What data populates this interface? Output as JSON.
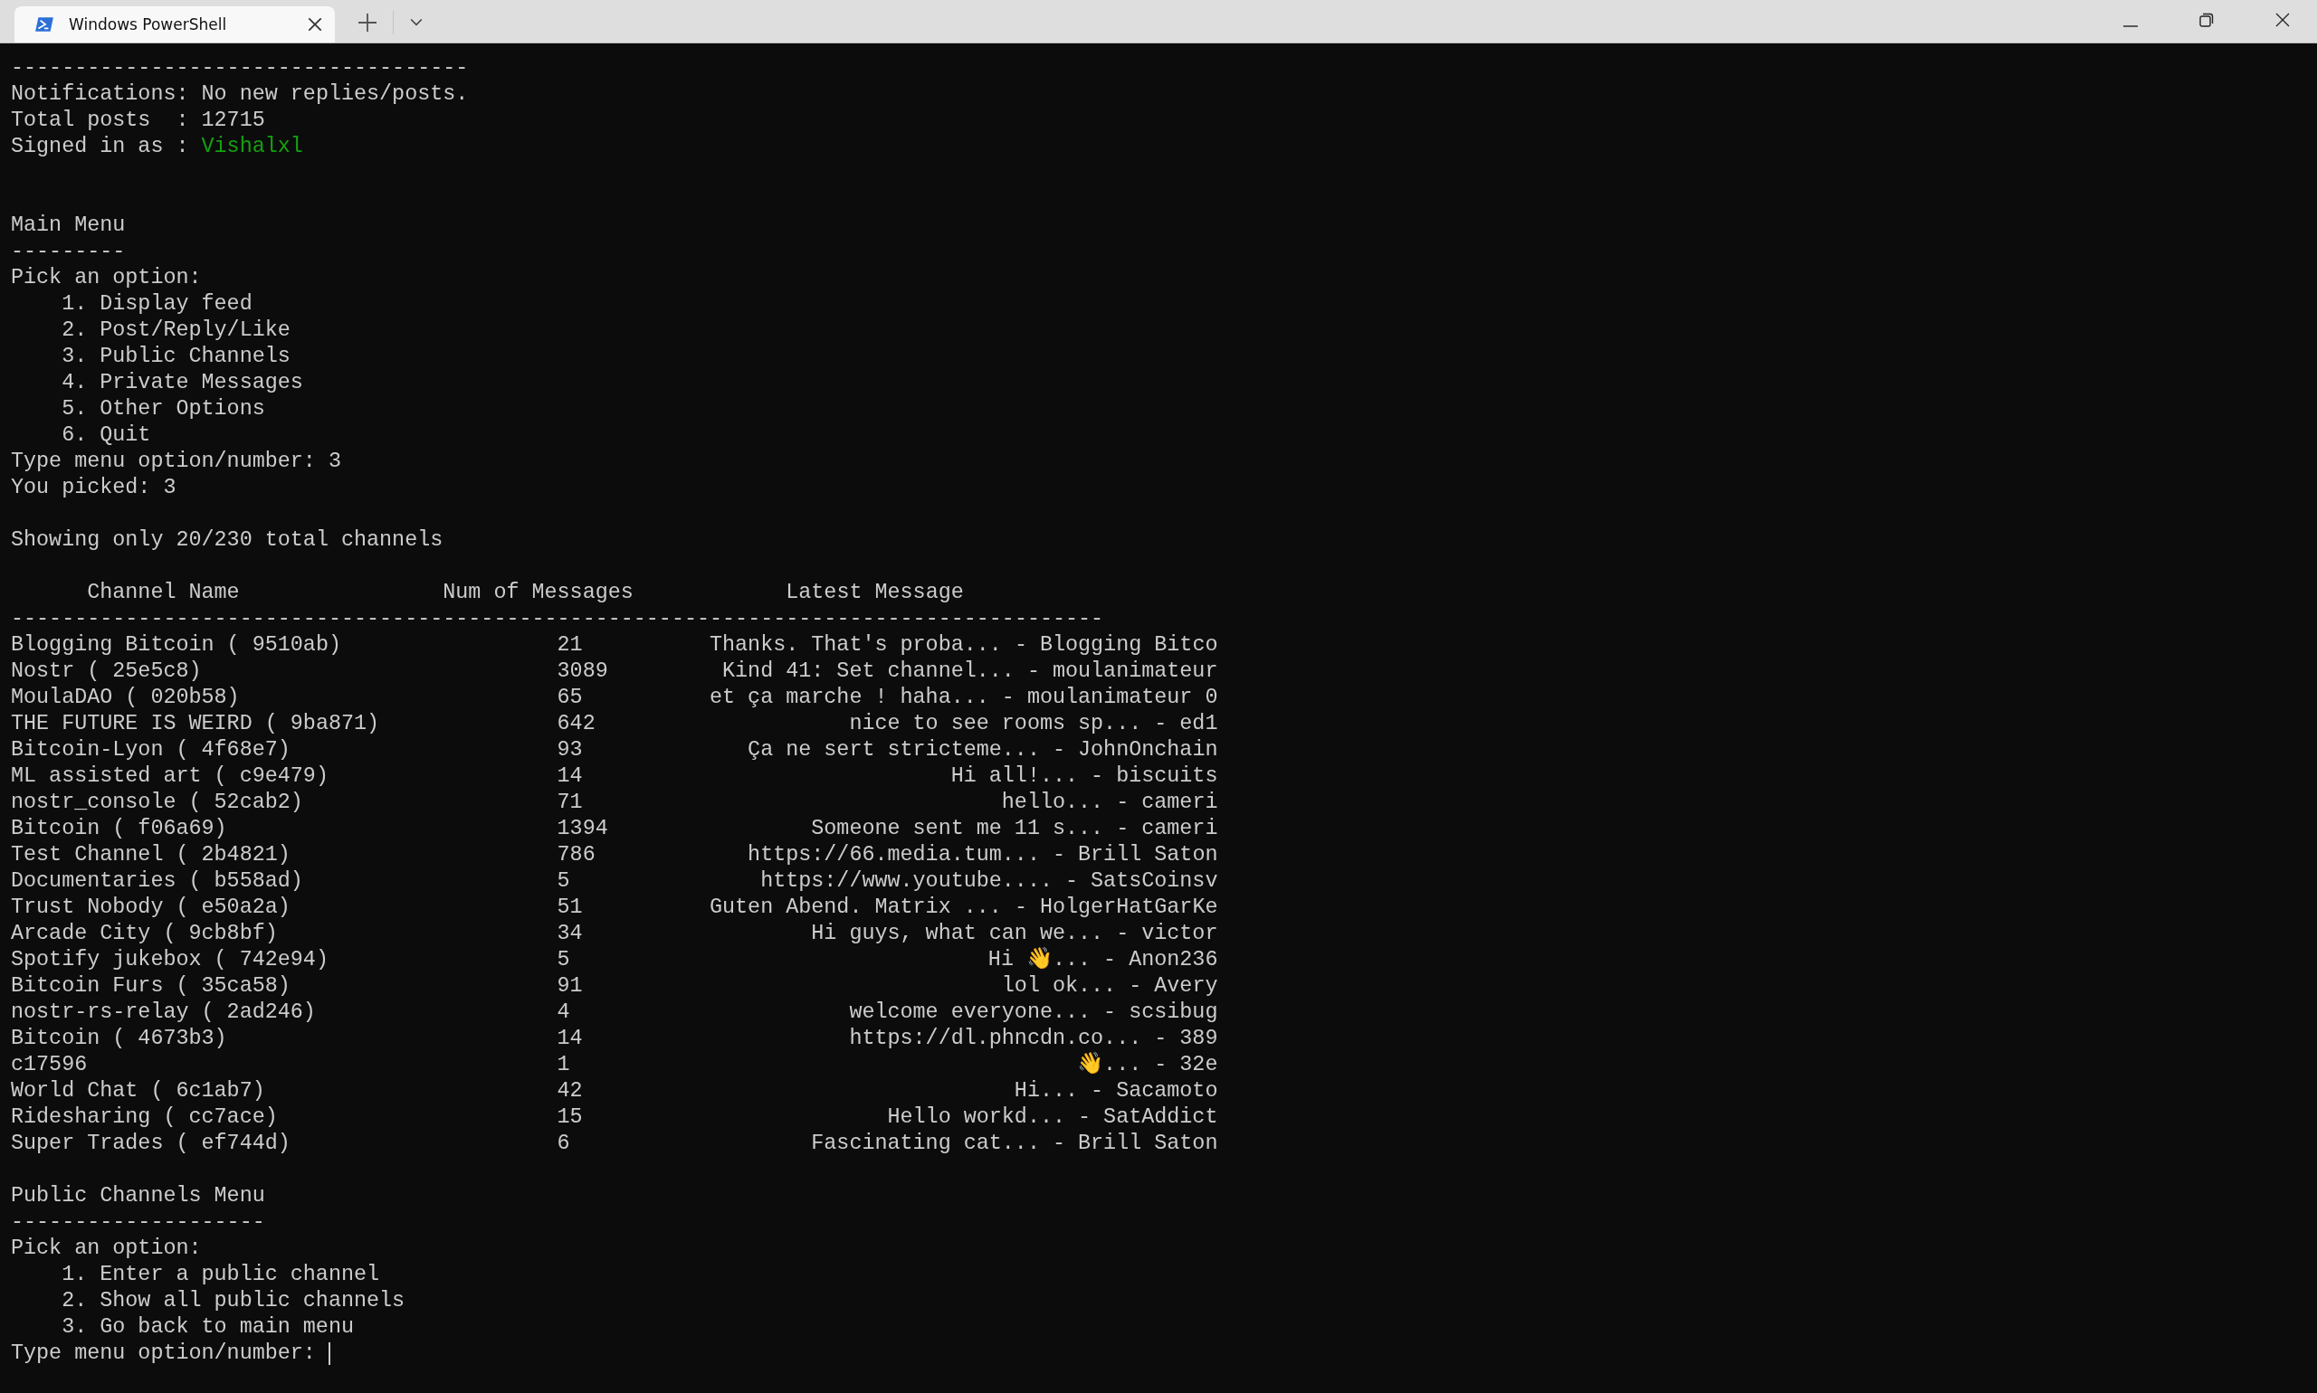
{
  "tab": {
    "title": "Windows PowerShell"
  },
  "header_rule": "------------------------------------",
  "notifications": "Notifications: No new replies/posts.",
  "total_posts": "Total posts  : 12715",
  "signed_in": {
    "label": "Signed in as :",
    "value": "Vishalxl"
  },
  "main_menu": {
    "title": "Main Menu",
    "rule": "---------",
    "prompt": "Pick an option:",
    "options": [
      "1. Display feed",
      "2. Post/Reply/Like",
      "3. Public Channels",
      "4. Private Messages",
      "5. Other Options",
      "6. Quit"
    ],
    "input_prompt": "Type menu option/number:",
    "input_value": "3",
    "echo": "You picked: 3"
  },
  "summary": "Showing only 20/230 total channels",
  "table": {
    "columns": [
      "Channel Name",
      "Num of Messages",
      "Latest Message"
    ],
    "rule": "--------------------------------------------------------------------------------------",
    "rows": [
      {
        "name": "Blogging Bitcoin ( 9510ab)",
        "messages": "21",
        "latest": "Thanks. That's proba... - Blogging Bitco"
      },
      {
        "name": "Nostr ( 25e5c8)",
        "messages": "3089",
        "latest": "Kind 41: Set channel... - moulanimateur"
      },
      {
        "name": "MoulaDAO ( 020b58)",
        "messages": "65",
        "latest": "et ça marche ! haha... - moulanimateur 0"
      },
      {
        "name": "THE FUTURE IS WEIRD ( 9ba871)",
        "messages": "642",
        "latest": "nice to see rooms sp... - ed1"
      },
      {
        "name": "Bitcoin-Lyon ( 4f68e7)",
        "messages": "93",
        "latest": "Ça ne sert stricteme... - JohnOnchain"
      },
      {
        "name": "ML assisted art ( c9e479)",
        "messages": "14",
        "latest": "Hi all!... - biscuits"
      },
      {
        "name": "nostr_console ( 52cab2)",
        "messages": "71",
        "latest": "hello... - cameri"
      },
      {
        "name": "Bitcoin ( f06a69)",
        "messages": "1394",
        "latest": "Someone sent me 11 s... - cameri"
      },
      {
        "name": "Test Channel ( 2b4821)",
        "messages": "786",
        "latest": "https://66.media.tum... - Brill Saton"
      },
      {
        "name": "Documentaries ( b558ad)",
        "messages": "5",
        "latest": "https://www.youtube.... - SatsCoinsv"
      },
      {
        "name": "Trust Nobody ( e50a2a)",
        "messages": "51",
        "latest": "Guten Abend. Matrix ... - HolgerHatGarKe"
      },
      {
        "name": "Arcade City ( 9cb8bf)",
        "messages": "34",
        "latest": "Hi guys, what can we... - victor"
      },
      {
        "name": "Spotify jukebox ( 742e94)",
        "messages": "5",
        "latest": "Hi 👋... - Anon236"
      },
      {
        "name": "Bitcoin Furs ( 35ca58)",
        "messages": "91",
        "latest": "lol ok... - Avery"
      },
      {
        "name": "nostr-rs-relay ( 2ad246)",
        "messages": "4",
        "latest": "welcome everyone... - scsibug"
      },
      {
        "name": "Bitcoin ( 4673b3)",
        "messages": "14",
        "latest": "https://dl.phncdn.co... - 389"
      },
      {
        "name": "c17596",
        "messages": "1",
        "latest": "👋... - 32e"
      },
      {
        "name": "World Chat ( 6c1ab7)",
        "messages": "42",
        "latest": "Hi... - Sacamoto"
      },
      {
        "name": "Ridesharing ( cc7ace)",
        "messages": "15",
        "latest": "Hello workd... - SatAddict"
      },
      {
        "name": "Super Trades ( ef744d)",
        "messages": "6",
        "latest": "Fascinating cat... - Brill Saton"
      }
    ]
  },
  "channels_menu": {
    "title": "Public Channels Menu",
    "rule": "--------------------",
    "prompt": "Pick an option:",
    "options": [
      "1. Enter a public channel",
      "2. Show all public channels",
      "3. Go back to main menu"
    ],
    "input_prompt": "Type menu option/number:"
  }
}
